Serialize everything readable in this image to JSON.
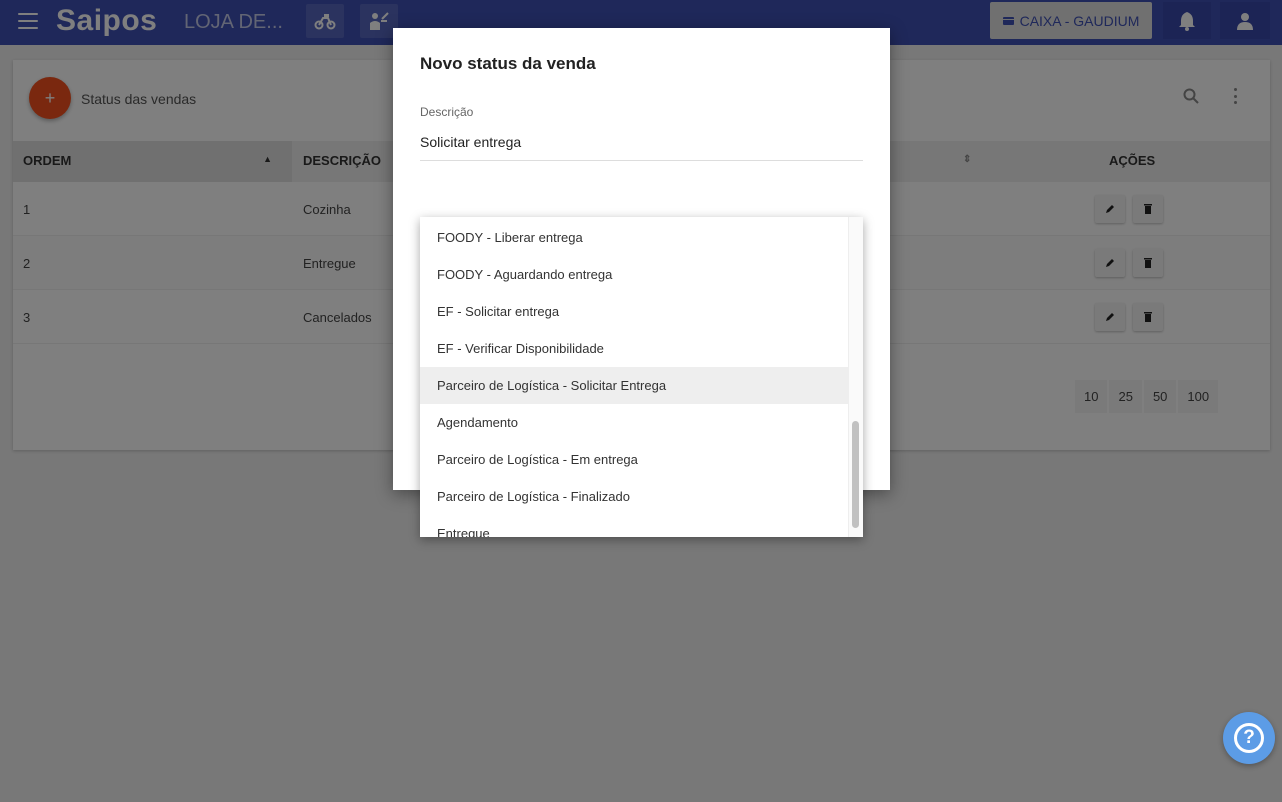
{
  "topbar": {
    "logo": "Saipos",
    "store_name": "LOJA DE...",
    "cash_register_label": "CAIXA - GAUDIUM"
  },
  "card": {
    "title": "Status das vendas",
    "add_label": "+",
    "columns": {
      "order": "ORDEM",
      "description": "DESCRIÇÃO",
      "actions": "AÇÕES"
    },
    "rows": [
      {
        "order": "1",
        "description": "Cozinha"
      },
      {
        "order": "2",
        "description": "Entregue"
      },
      {
        "order": "3",
        "description": "Cancelados"
      }
    ],
    "page_sizes": [
      "10",
      "25",
      "50",
      "100"
    ]
  },
  "dialog": {
    "title": "Novo status da venda",
    "description_label": "Descrição",
    "description_value": "Solicitar entrega"
  },
  "dropdown": {
    "selected_index": 4,
    "options": [
      "FOODY - Liberar entrega",
      "FOODY - Aguardando entrega",
      "EF - Solicitar entrega",
      "EF - Verificar Disponibilidade",
      "Parceiro de Logística - Solicitar Entrega",
      "Agendamento",
      "Parceiro de Logística - Em entrega",
      "Parceiro de Logística - Finalizado",
      "Entregue"
    ]
  },
  "colors": {
    "primary": "#3f51b5",
    "accent": "#f4511e",
    "help": "#5c9ce6"
  },
  "icons": [
    "menu-icon",
    "motorcycle-icon",
    "waiter-icon",
    "credit-card-icon",
    "bell-icon",
    "user-icon",
    "search-icon",
    "more-vert-icon",
    "edit-icon",
    "delete-icon",
    "help-icon"
  ]
}
